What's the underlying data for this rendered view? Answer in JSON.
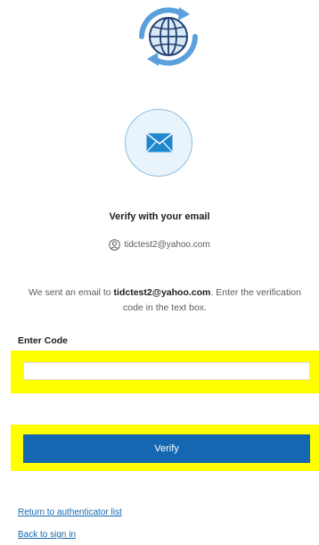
{
  "brand": {
    "logo_icon": "globe-refresh-icon",
    "accent": "#1467b0",
    "logo_color": "#4a90d9"
  },
  "authenticator": {
    "icon": "envelope-icon",
    "title": "Verify with your email",
    "identifier_icon": "user-circle-icon",
    "identifier": "tidctest2@yahoo.com"
  },
  "instructions": {
    "prefix": "We sent an email to ",
    "email": "tidctest2@yahoo.com",
    "suffix": ". Enter the verification code in the text box."
  },
  "form": {
    "code_label": "Enter Code",
    "code_value": "",
    "verify_label": "Verify"
  },
  "links": {
    "return": "Return to authenticator list",
    "back": "Back to sign in"
  },
  "highlight_color": "#ffff00"
}
